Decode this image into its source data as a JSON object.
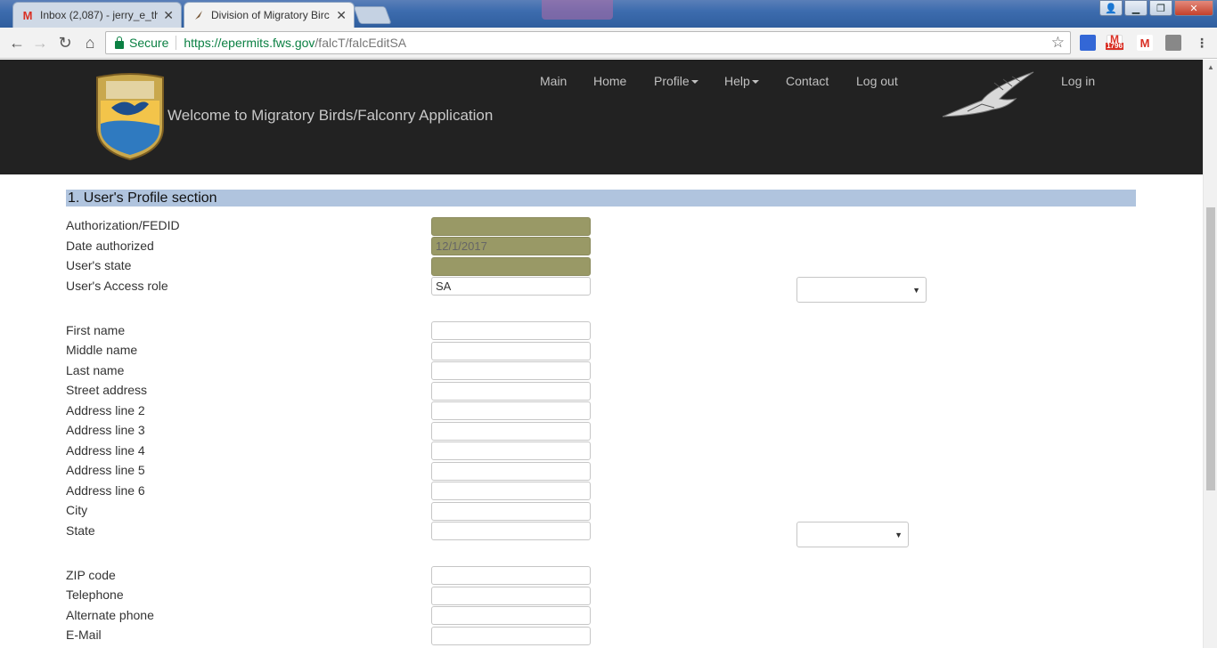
{
  "browser": {
    "tabs": [
      {
        "title": "Inbox (2,087) - jerry_e_th",
        "icon": "gmail-icon"
      },
      {
        "title": "Division of Migratory Birc",
        "icon": "bird-favicon"
      }
    ],
    "secure_label": "Secure",
    "url_host": "https://epermits.fws.gov",
    "url_path": "/falcT/falcEditSA",
    "ext_badge": "1796"
  },
  "header": {
    "title": "Welcome to Migratory Birds/Falconry Application",
    "nav": {
      "main": "Main",
      "home": "Home",
      "profile": "Profile",
      "help": "Help",
      "contact": "Contact",
      "logout": "Log out",
      "login": "Log in"
    },
    "shield_text": {
      "top": "U.S.",
      "line2": "FISH & WILDLIFE",
      "line3": "SERVICE"
    }
  },
  "section": {
    "title": "1. User's Profile section"
  },
  "fields": {
    "fedid": {
      "label": "Authorization/FEDID",
      "value": ""
    },
    "date_authorized": {
      "label": "Date authorized",
      "value": "12/1/2017"
    },
    "users_state": {
      "label": "User's state",
      "value": ""
    },
    "access_role": {
      "label": "User's Access role",
      "value": "SA"
    },
    "first_name": {
      "label": "First name",
      "value": ""
    },
    "middle_name": {
      "label": "Middle name",
      "value": ""
    },
    "last_name": {
      "label": "Last name",
      "value": ""
    },
    "street": {
      "label": "Street address",
      "value": ""
    },
    "addr2": {
      "label": "Address line 2",
      "value": ""
    },
    "addr3": {
      "label": "Address line 3",
      "value": ""
    },
    "addr4": {
      "label": "Address line 4",
      "value": ""
    },
    "addr5": {
      "label": "Address line 5",
      "value": ""
    },
    "addr6": {
      "label": "Address line 6",
      "value": ""
    },
    "city": {
      "label": "City",
      "value": ""
    },
    "state": {
      "label": "State",
      "value": ""
    },
    "zip": {
      "label": "ZIP code",
      "value": ""
    },
    "telephone": {
      "label": "Telephone",
      "value": ""
    },
    "alt_phone": {
      "label": "Alternate phone",
      "value": ""
    },
    "email": {
      "label": "E-Mail",
      "value": ""
    }
  },
  "colors": {
    "header_bg": "#222222",
    "section_bar": "#b0c4de",
    "readonly_field": "#999966"
  }
}
